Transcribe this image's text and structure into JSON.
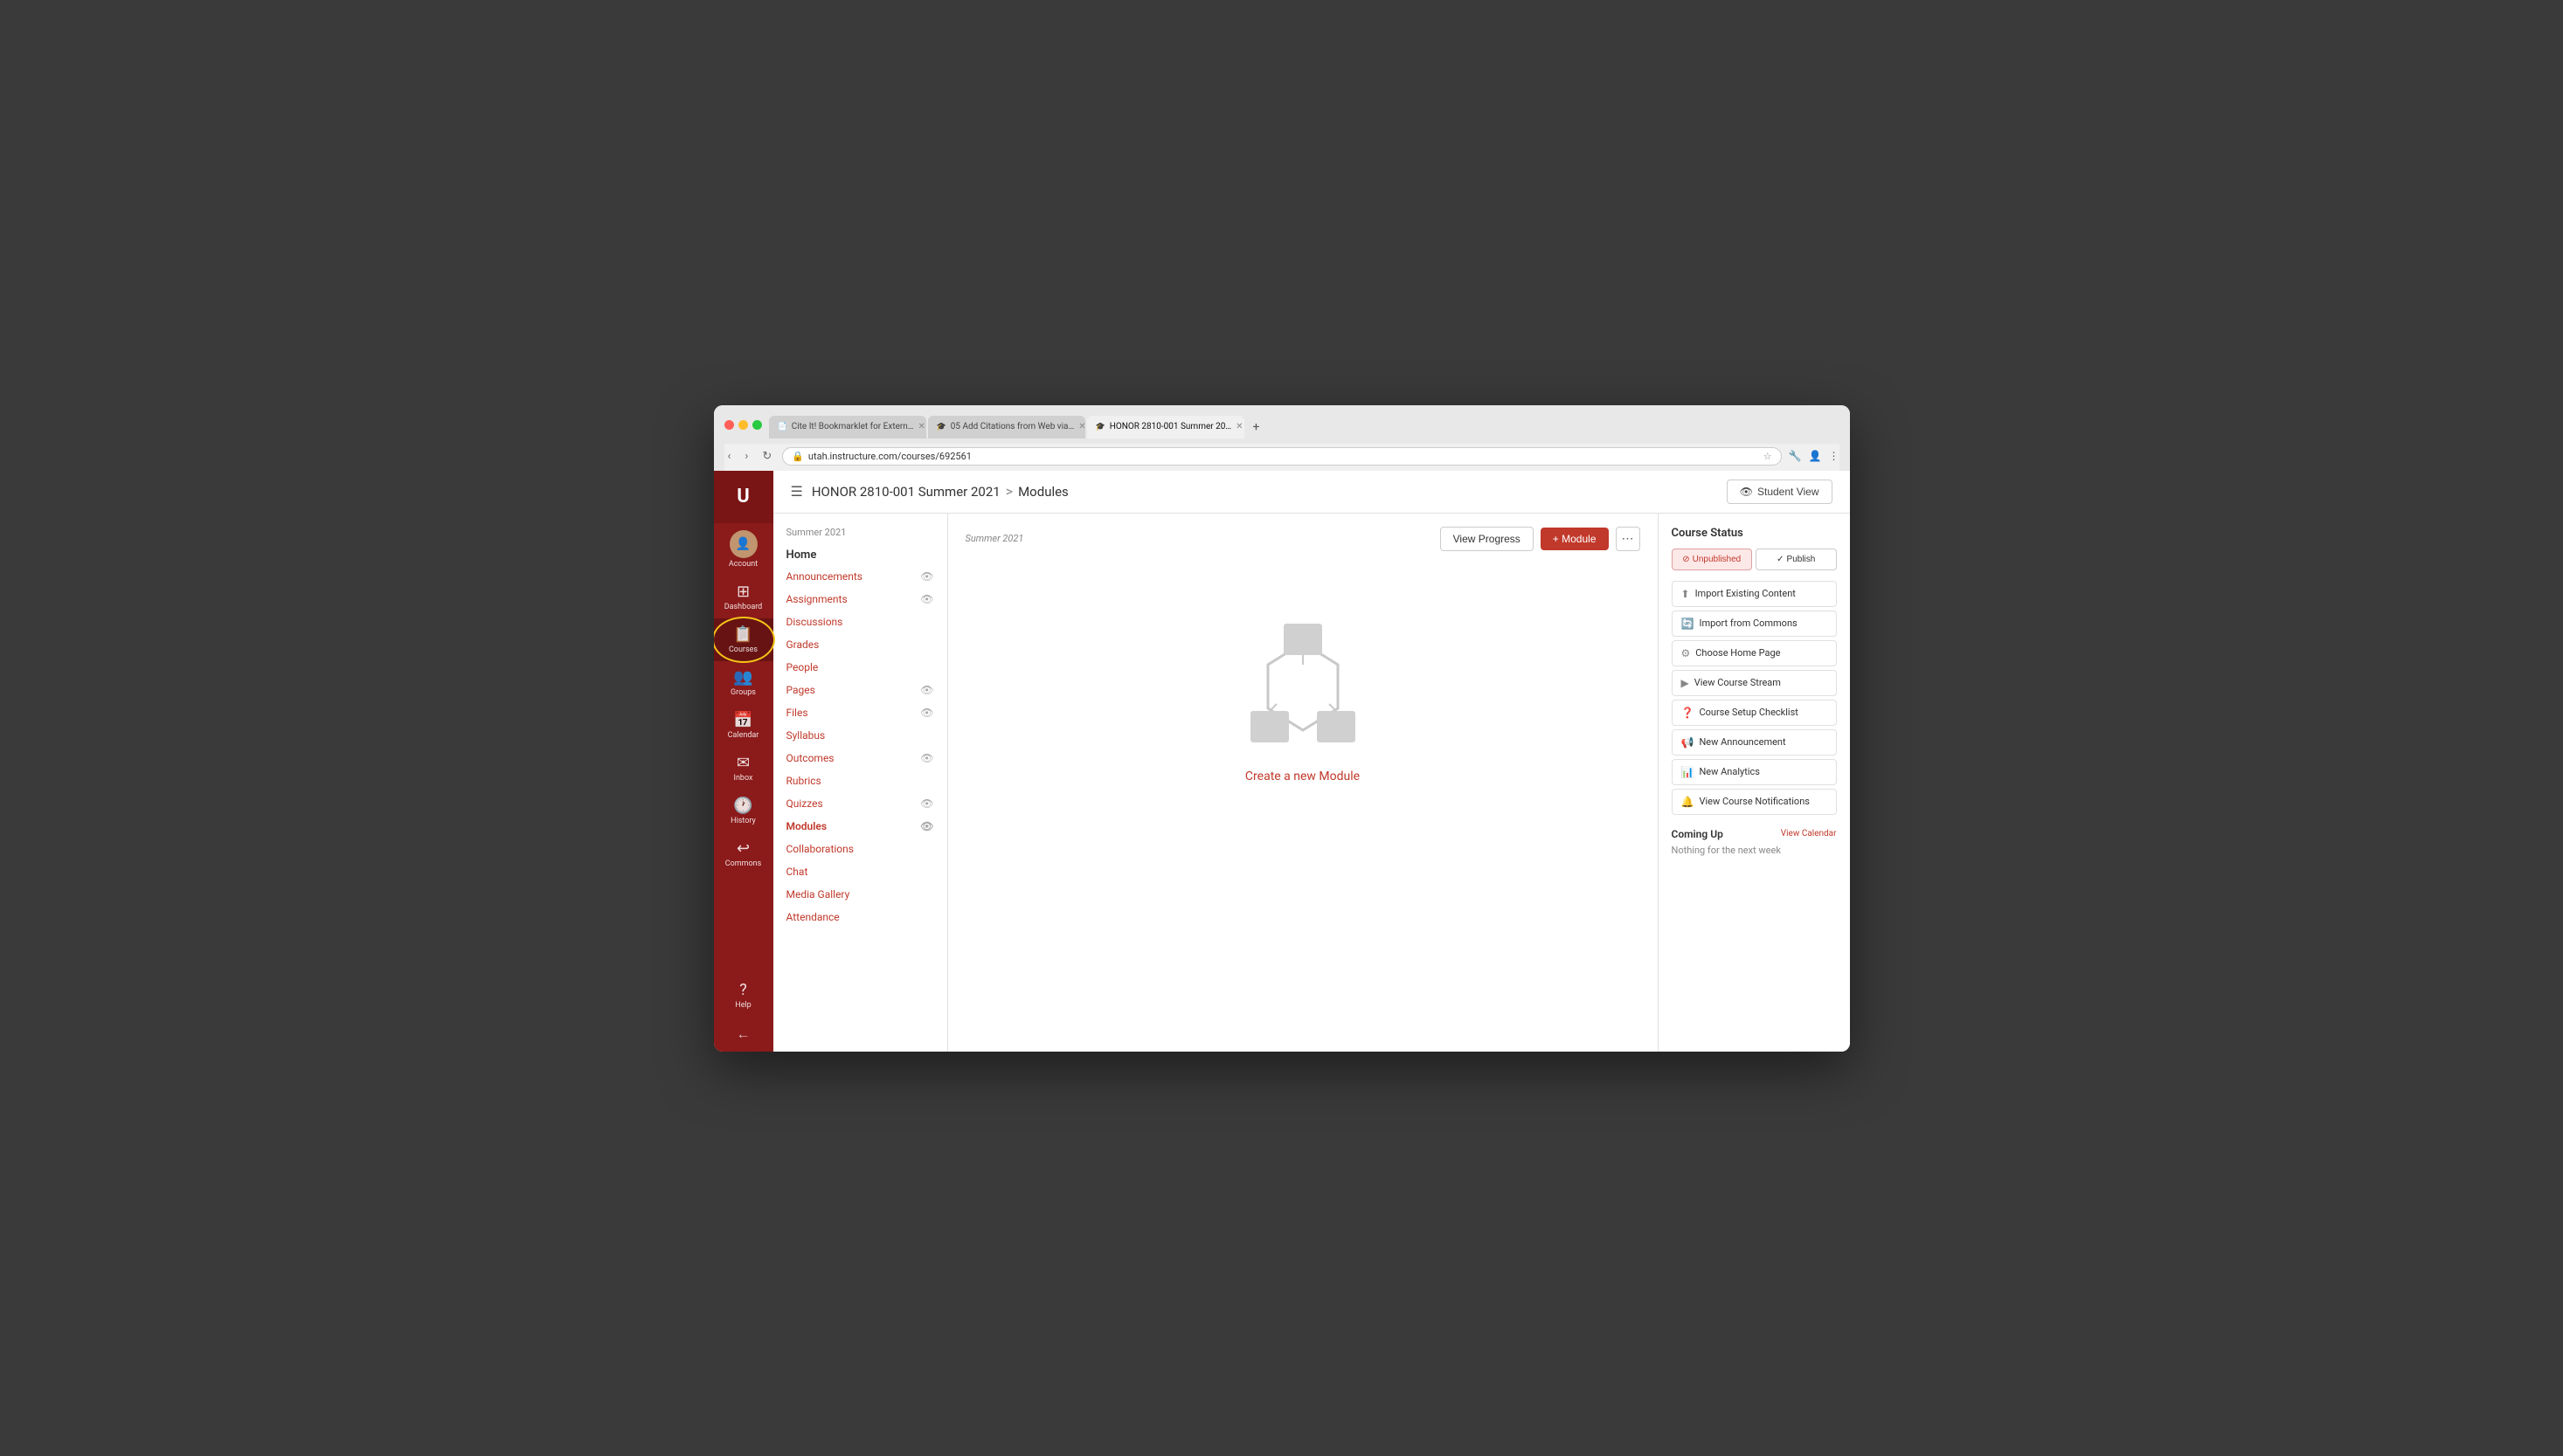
{
  "browser": {
    "tabs": [
      {
        "label": "Cite It! Bookmarklet for Extern…",
        "favicon": "📄",
        "active": false
      },
      {
        "label": "05 Add Citations from Web via…",
        "favicon": "🎓",
        "active": false
      },
      {
        "label": "HONOR 2810-001 Summer 20…",
        "favicon": "🎓",
        "active": true
      }
    ],
    "address": "utah.instructure.com/courses/692561",
    "new_tab_label": "+"
  },
  "header": {
    "breadcrumb_course": "HONOR 2810-001 Summer 2021",
    "breadcrumb_sep": ">",
    "breadcrumb_page": "Modules",
    "student_view_label": "Student View"
  },
  "sidebar": {
    "logo": "U",
    "items": [
      {
        "id": "account",
        "label": "Account",
        "icon": "👤"
      },
      {
        "id": "dashboard",
        "label": "Dashboard",
        "icon": "⊞"
      },
      {
        "id": "courses",
        "label": "Courses",
        "icon": "📋",
        "active": true
      },
      {
        "id": "groups",
        "label": "Groups",
        "icon": "👥"
      },
      {
        "id": "calendar",
        "label": "Calendar",
        "icon": "📅"
      },
      {
        "id": "inbox",
        "label": "Inbox",
        "icon": "✉️"
      },
      {
        "id": "history",
        "label": "History",
        "icon": "🕐"
      },
      {
        "id": "commons",
        "label": "Commons",
        "icon": "↩"
      }
    ],
    "bottom_items": [
      {
        "id": "help",
        "label": "Help",
        "icon": "?"
      }
    ],
    "collapse_icon": "←"
  },
  "left_nav": {
    "semester": "Summer 2021",
    "home_label": "Home",
    "items": [
      {
        "label": "Announcements",
        "has_eye": true
      },
      {
        "label": "Assignments",
        "has_eye": true
      },
      {
        "label": "Discussions",
        "has_eye": false
      },
      {
        "label": "Grades",
        "has_eye": false
      },
      {
        "label": "People",
        "has_eye": false
      },
      {
        "label": "Pages",
        "has_eye": true
      },
      {
        "label": "Files",
        "has_eye": true
      },
      {
        "label": "Syllabus",
        "has_eye": false
      },
      {
        "label": "Outcomes",
        "has_eye": true
      },
      {
        "label": "Rubrics",
        "has_eye": false
      },
      {
        "label": "Quizzes",
        "has_eye": true
      },
      {
        "label": "Modules",
        "has_eye": true,
        "active": true
      },
      {
        "label": "Collaborations",
        "has_eye": false
      },
      {
        "label": "Chat",
        "has_eye": false
      },
      {
        "label": "Media Gallery",
        "has_eye": false
      },
      {
        "label": "Attendance",
        "has_eye": false
      }
    ]
  },
  "module_area": {
    "semester_label": "Summer 2021",
    "view_progress_label": "View Progress",
    "add_module_label": "+ Module",
    "empty_state_label": "Create a new Module"
  },
  "right_sidebar": {
    "course_status_title": "Course Status",
    "unpublished_label": "Unpublished",
    "publish_label": "Publish",
    "links": [
      {
        "label": "Import Existing Content",
        "icon": "⬆"
      },
      {
        "label": "Import from Commons",
        "icon": "🔄"
      },
      {
        "label": "Choose Home Page",
        "icon": "⚙"
      },
      {
        "label": "View Course Stream",
        "icon": "🎬"
      },
      {
        "label": "Course Setup Checklist",
        "icon": "❓"
      },
      {
        "label": "New Announcement",
        "icon": "📢"
      },
      {
        "label": "New Analytics",
        "icon": "📊"
      },
      {
        "label": "View Course Notifications",
        "icon": "🔔"
      }
    ],
    "coming_up_title": "Coming Up",
    "view_calendar_label": "View Calendar",
    "coming_up_empty": "Nothing for the next week"
  }
}
